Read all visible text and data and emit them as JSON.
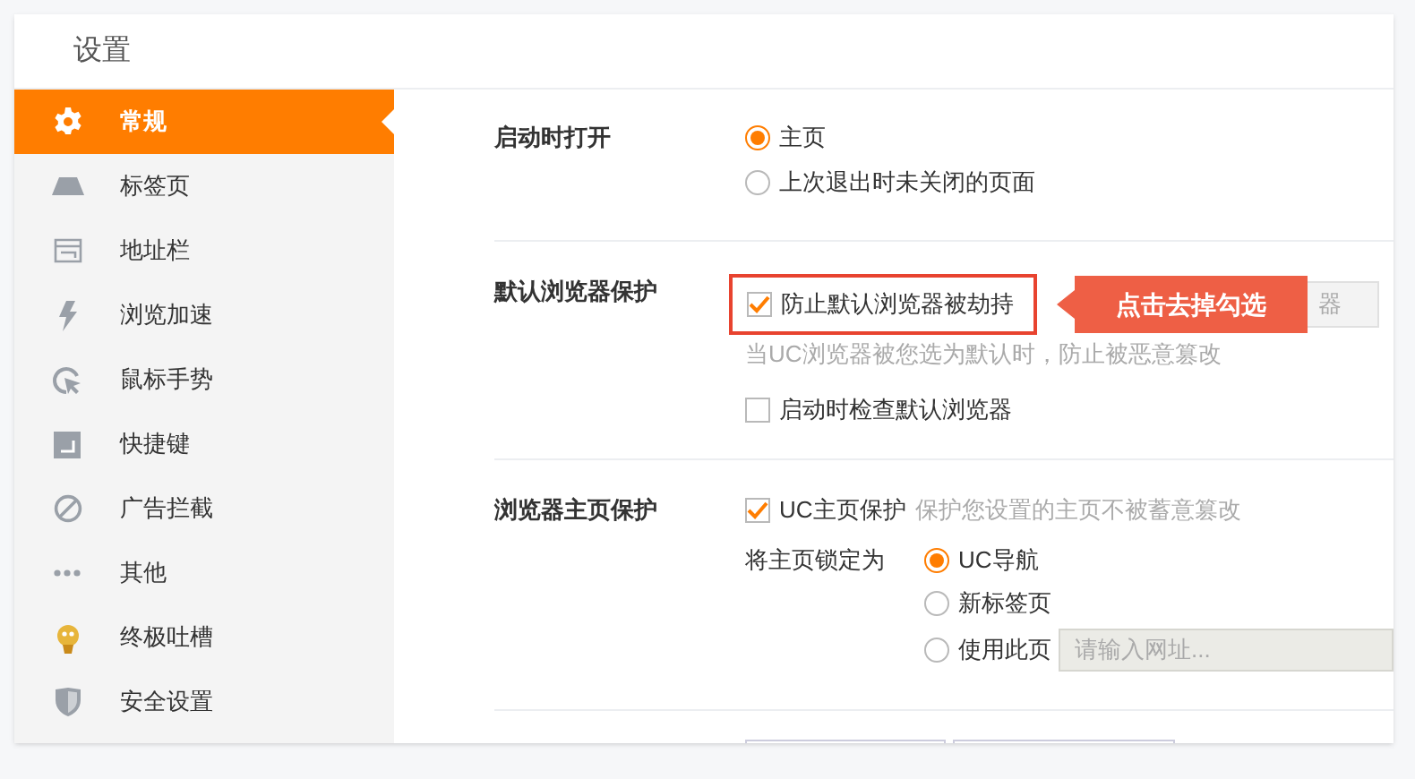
{
  "window": {
    "title": "设置"
  },
  "sidebar": {
    "items": [
      {
        "label": "常规",
        "selected": true
      },
      {
        "label": "标签页",
        "selected": false
      },
      {
        "label": "地址栏",
        "selected": false
      },
      {
        "label": "浏览加速",
        "selected": false
      },
      {
        "label": "鼠标手势",
        "selected": false
      },
      {
        "label": "快捷键",
        "selected": false
      },
      {
        "label": "广告拦截",
        "selected": false
      },
      {
        "label": "其他",
        "selected": false
      },
      {
        "label": "终极吐槽",
        "selected": false
      },
      {
        "label": "安全设置",
        "selected": false
      }
    ]
  },
  "startup": {
    "label": "启动时打开",
    "options": [
      {
        "label": "主页",
        "selected": true
      },
      {
        "label": "上次退出时未关闭的页面",
        "selected": false
      }
    ]
  },
  "default_browser": {
    "label": "默认浏览器保护",
    "protect": {
      "label": "防止默认浏览器被劫持",
      "checked": true
    },
    "button": "器",
    "callout": "点击去掉勾选",
    "hint": "当UC浏览器被您选为默认时，防止被恶意篡改",
    "check_on_start": {
      "label": "启动时检查默认浏览器",
      "checked": false
    }
  },
  "homepage": {
    "label": "浏览器主页保护",
    "protect": {
      "label": "UC主页保护",
      "checked": true
    },
    "note": "保护您设置的主页不被蓄意篡改",
    "lock_label": "将主页锁定为",
    "options": [
      {
        "label": "UC导航",
        "selected": true
      },
      {
        "label": "新标签页",
        "selected": false
      },
      {
        "label": "使用此页",
        "selected": false,
        "placeholder": "请输入网址..."
      }
    ]
  }
}
